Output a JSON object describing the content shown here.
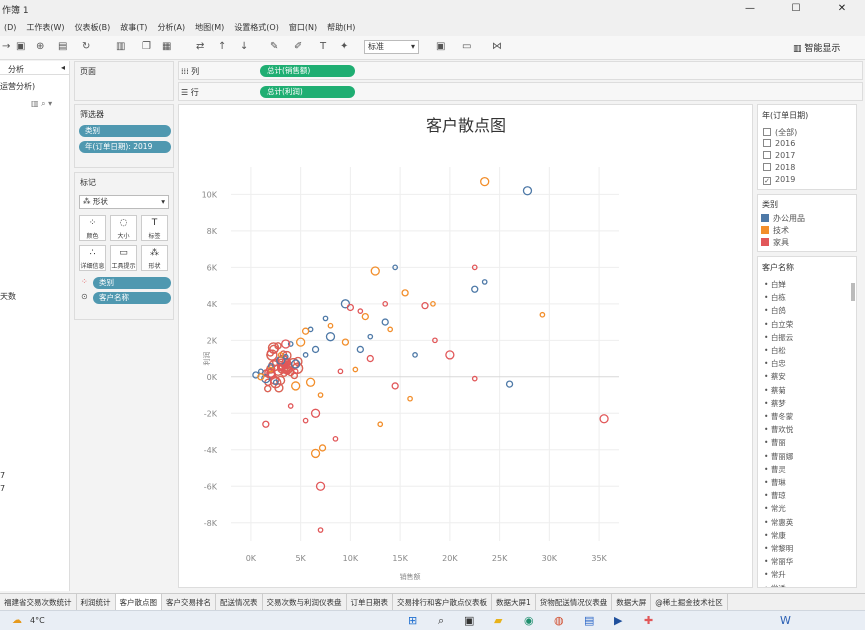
{
  "window": {
    "title": "作簿 1",
    "min": "—",
    "max": "☐",
    "close": "✕"
  },
  "menu": [
    "(D)",
    "工作表(W)",
    "仪表板(B)",
    "故事(T)",
    "分析(A)",
    "地图(M)",
    "设置格式(O)",
    "窗口(N)",
    "帮助(H)"
  ],
  "toolbar": {
    "mark_type": "标准",
    "smart_show": "智能显示"
  },
  "left": {
    "tab": "分析",
    "item": "运营分析)",
    "measure": "天数",
    "n1": "7",
    "n2": "7"
  },
  "pages": {
    "title": "页面"
  },
  "shelves": {
    "columns_label": "列",
    "columns_pill": "总计(销售额)",
    "rows_label": "行",
    "rows_pill": "总计(利润)"
  },
  "filters": {
    "title": "筛选器",
    "items": [
      "类别",
      "年(订单日期): 2019"
    ]
  },
  "marks": {
    "title": "标记",
    "type": "形状",
    "cards": [
      "颜色",
      "大小",
      "标签",
      "详细信息",
      "工具提示",
      "形状"
    ],
    "pills": [
      "类别",
      "客户名称"
    ]
  },
  "chart_data": {
    "type": "scatter",
    "title": "客户散点图",
    "xlabel": "销售额",
    "ylabel": "利润",
    "xlim": [
      -2000,
      37000
    ],
    "ylim": [
      -9000,
      11500
    ],
    "x_ticks": [
      "0K",
      "5K",
      "10K",
      "15K",
      "20K",
      "25K",
      "30K",
      "35K"
    ],
    "x_tick_values": [
      0,
      5000,
      10000,
      15000,
      20000,
      25000,
      30000,
      35000
    ],
    "y_ticks": [
      "10K",
      "8K",
      "6K",
      "4K",
      "2K",
      "0K",
      "-2K",
      "-4K",
      "-6K",
      "-8K"
    ],
    "y_tick_values": [
      10000,
      8000,
      6000,
      4000,
      2000,
      0,
      -2000,
      -4000,
      -6000,
      -8000
    ],
    "grid": true,
    "series": [
      {
        "name": "办公用品",
        "color": "#4e79a7",
        "points": [
          [
            27800,
            10200
          ],
          [
            14500,
            6000
          ],
          [
            23500,
            5200
          ],
          [
            22500,
            4800
          ],
          [
            9500,
            4000
          ],
          [
            7500,
            3200
          ],
          [
            13500,
            3000
          ],
          [
            6000,
            2600
          ],
          [
            8000,
            2200
          ],
          [
            11000,
            1500
          ],
          [
            4000,
            1800
          ],
          [
            5500,
            1200
          ],
          [
            3000,
            900
          ],
          [
            2000,
            600
          ],
          [
            1000,
            300
          ],
          [
            500,
            100
          ],
          [
            1500,
            -100
          ],
          [
            2500,
            -300
          ],
          [
            26000,
            -400
          ],
          [
            3500,
            1100
          ],
          [
            4500,
            700
          ],
          [
            6500,
            1500
          ],
          [
            12000,
            2200
          ],
          [
            16500,
            1200
          ]
        ]
      },
      {
        "name": "技术",
        "color": "#f28e2b",
        "points": [
          [
            23500,
            10700
          ],
          [
            29300,
            3400
          ],
          [
            18300,
            4000
          ],
          [
            15500,
            4600
          ],
          [
            12500,
            5800
          ],
          [
            8000,
            2800
          ],
          [
            9500,
            1900
          ],
          [
            7000,
            -1000
          ],
          [
            6500,
            -4200
          ],
          [
            7200,
            -3900
          ],
          [
            13000,
            -2600
          ],
          [
            10500,
            400
          ],
          [
            5000,
            1900
          ],
          [
            3000,
            1200
          ],
          [
            2000,
            400
          ],
          [
            1000,
            0
          ],
          [
            4500,
            -500
          ],
          [
            16000,
            -1200
          ],
          [
            11500,
            3300
          ],
          [
            14000,
            2600
          ],
          [
            6000,
            -300
          ],
          [
            5500,
            2500
          ]
        ]
      },
      {
        "name": "家具",
        "color": "#e15759",
        "points": [
          [
            35500,
            -2300
          ],
          [
            22500,
            6000
          ],
          [
            22500,
            -100
          ],
          [
            17500,
            3900
          ],
          [
            7000,
            -6000
          ],
          [
            7000,
            -8400
          ],
          [
            1500,
            -2600
          ],
          [
            5500,
            -2400
          ],
          [
            3500,
            1800
          ],
          [
            10000,
            3800
          ],
          [
            11000,
            3600
          ],
          [
            13500,
            4000
          ],
          [
            6500,
            -2000
          ],
          [
            8500,
            -3400
          ],
          [
            4500,
            300
          ],
          [
            3000,
            500
          ],
          [
            2000,
            200
          ],
          [
            9000,
            300
          ],
          [
            14500,
            -500
          ],
          [
            18500,
            2000
          ],
          [
            20000,
            1200
          ],
          [
            12000,
            1000
          ],
          [
            4000,
            -1600
          ]
        ]
      }
    ]
  },
  "right": {
    "date_title": "年(订单日期)",
    "years": [
      {
        "label": "(全部)",
        "checked": false
      },
      {
        "label": "2016",
        "checked": false
      },
      {
        "label": "2017",
        "checked": false
      },
      {
        "label": "2018",
        "checked": false
      },
      {
        "label": "2019",
        "checked": true
      }
    ],
    "category_title": "类别",
    "categories": [
      {
        "label": "办公用品",
        "color": "#4e79a7"
      },
      {
        "label": "技术",
        "color": "#f28e2b"
      },
      {
        "label": "家具",
        "color": "#e15759"
      }
    ],
    "customer_title": "客户名称",
    "customers": [
      "白婵",
      "白栋",
      "白鸽",
      "白立荣",
      "白振云",
      "白松",
      "白忠",
      "蔡安",
      "蔡菊",
      "蔡梦",
      "曹冬蒙",
      "曹欢悦",
      "曹丽",
      "曹丽娜",
      "曹灵",
      "曹琳",
      "曹琼",
      "常光",
      "常惠英",
      "常康",
      "常黎明",
      "常丽华",
      "常升",
      "常透"
    ]
  },
  "tabs": [
    "福建省交易次数统计",
    "利润统计",
    "客户散点图",
    "客户交易排名",
    "配送情况表",
    "交易次数与利润仪表盘",
    "订单日期表",
    "交易排行和客户散点仪表板",
    "数据大屏1",
    "货物配送情况仪表盘",
    "数据大屏",
    "@稀土掘金技术社区"
  ],
  "active_tab": "客户散点图",
  "taskbar": {
    "weather": "4°C"
  }
}
